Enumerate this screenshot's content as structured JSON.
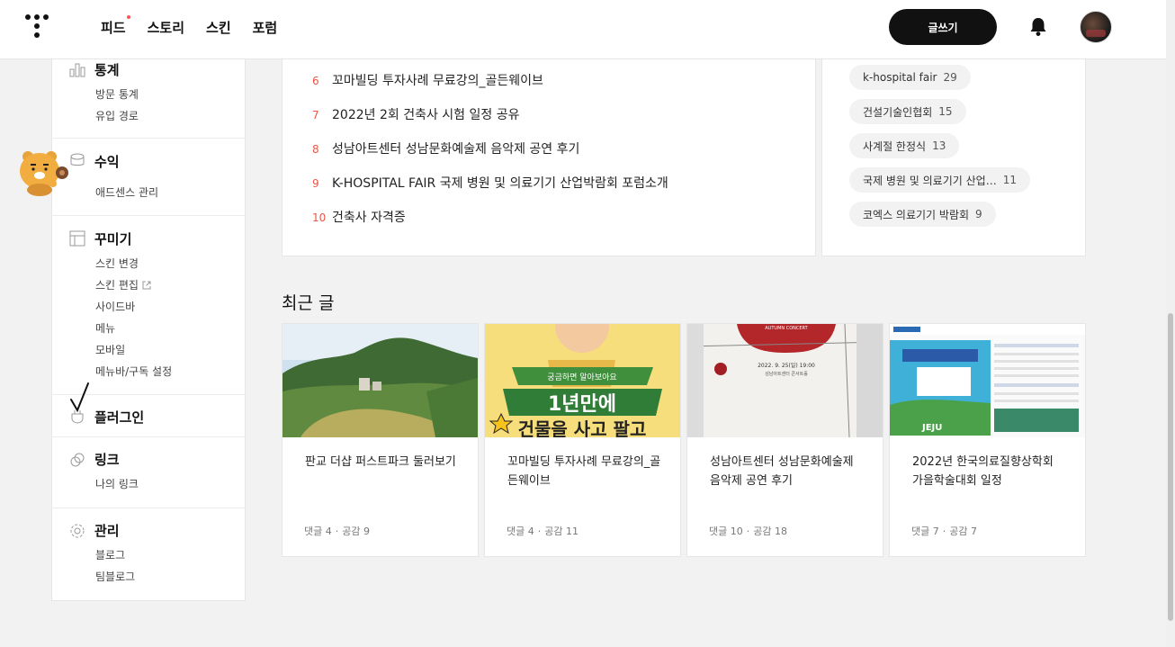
{
  "nav": {
    "items": [
      "피드",
      "스토리",
      "스킨",
      "포럼"
    ],
    "write_label": "글쓰기"
  },
  "icons": {
    "logo": "tistory-logo-icon",
    "bell": "bell-icon",
    "avatar": "user-avatar"
  },
  "sidebar": {
    "stats": {
      "title": "통계",
      "links": [
        "방문 통계",
        "유입 경로"
      ]
    },
    "revenue": {
      "title": "수익",
      "links": [
        "애드센스 관리"
      ]
    },
    "decorate": {
      "title": "꾸미기",
      "links": [
        "스킨 변경",
        "스킨 편집",
        "사이드바",
        "메뉴",
        "모바일",
        "메뉴바/구독 설정"
      ]
    },
    "plugin": {
      "title": "플러그인"
    },
    "link": {
      "title": "링크",
      "links": [
        "나의 링크"
      ]
    },
    "manage": {
      "title": "관리",
      "links": [
        "블로그",
        "팀블로그"
      ]
    }
  },
  "popular": {
    "items": [
      {
        "num": "6",
        "title": "꼬마빌딩 투자사례 무료강의_골든웨이브"
      },
      {
        "num": "7",
        "title": "2022년 2회 건축사 시험 일정 공유"
      },
      {
        "num": "8",
        "title": "성남아트센터 성남문화예술제 음악제 공연 후기"
      },
      {
        "num": "9",
        "title": "K-HOSPITAL FAIR 국제 병원 및 의료기기 산업박람회 포럼소개"
      },
      {
        "num": "10",
        "title": "건축사 자격증"
      }
    ]
  },
  "tags": [
    {
      "name": "k-hospital fair",
      "count": "29"
    },
    {
      "name": "건설기술인협회",
      "count": "15"
    },
    {
      "name": "사계절 한정식",
      "count": "13"
    },
    {
      "name": "국제 병원 및 의료기기 산업…",
      "count": "11"
    },
    {
      "name": "코엑스 의료기기 박람회",
      "count": "9"
    }
  ],
  "recent": {
    "title": "최근 글",
    "posts": [
      {
        "title": "판교 더샵 퍼스트파크 둘러보기",
        "meta_comments": "댓글 4",
        "meta_likes": "공감 9"
      },
      {
        "title": "꼬마빌딩 투자사례 무료강의_골든웨이브",
        "meta_comments": "댓글 4",
        "meta_likes": "공감 11"
      },
      {
        "title": "성남아트센터 성남문화예술제 음악제 공연 후기",
        "meta_comments": "댓글 10",
        "meta_likes": "공감 18"
      },
      {
        "title": "2022년 한국의료질향상학회 가을학술대회 일정",
        "meta_comments": "댓글 7",
        "meta_likes": "공감 7"
      }
    ],
    "thumb_texts": {
      "banner_small": "궁금하면 알아보아요",
      "banner_big": "1년만에",
      "banner_big2": "건물을 사고 팔고",
      "concert": "AUTUMN CONCERT",
      "concert_date": "2022. 9. 25(일) 19:00",
      "concert_venue": "성남아트센터 콘서트홀",
      "jeju": "JEJU"
    }
  }
}
